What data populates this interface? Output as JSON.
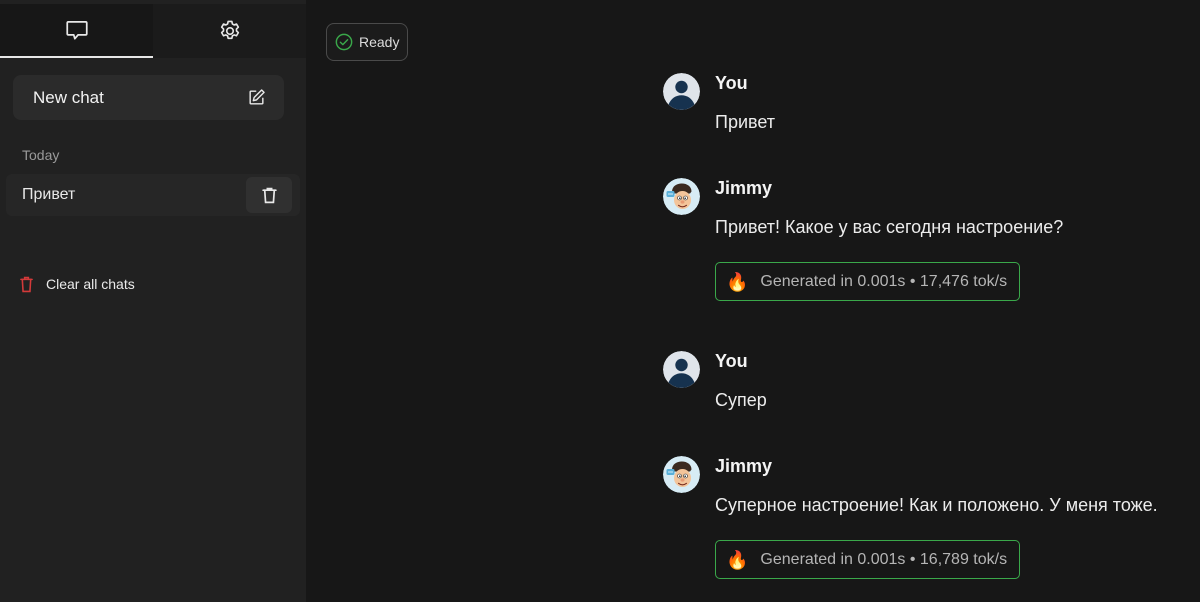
{
  "sidebar": {
    "tabs": [
      {
        "name": "chats",
        "icon": "chat-bubble-icon",
        "active": true
      },
      {
        "name": "settings",
        "icon": "gear-icon",
        "active": false
      }
    ],
    "new_chat_label": "New chat",
    "section_label": "Today",
    "history": [
      {
        "title": "Привет"
      }
    ],
    "clear_all_label": "Clear all chats"
  },
  "status": {
    "label": "Ready",
    "color": "#3aa84a"
  },
  "messages": [
    {
      "author": "You",
      "text": "Привет",
      "avatar": "user-avatar"
    },
    {
      "author": "Jimmy",
      "text": "Привет! Какое у вас сегодня настроение?",
      "avatar": "assistant-avatar",
      "stats": "Generated in 0.001s • 17,476 tok/s"
    },
    {
      "author": "You",
      "text": "Супер",
      "avatar": "user-avatar"
    },
    {
      "author": "Jimmy",
      "text": "Суперное настроение! Как и положено. У меня тоже.",
      "avatar": "assistant-avatar",
      "stats": "Generated in 0.001s • 16,789 tok/s"
    }
  ],
  "colors": {
    "background": "#171717",
    "sidebar": "#212121",
    "accent_green": "#3aa84a",
    "danger_red": "#d33a3a"
  }
}
